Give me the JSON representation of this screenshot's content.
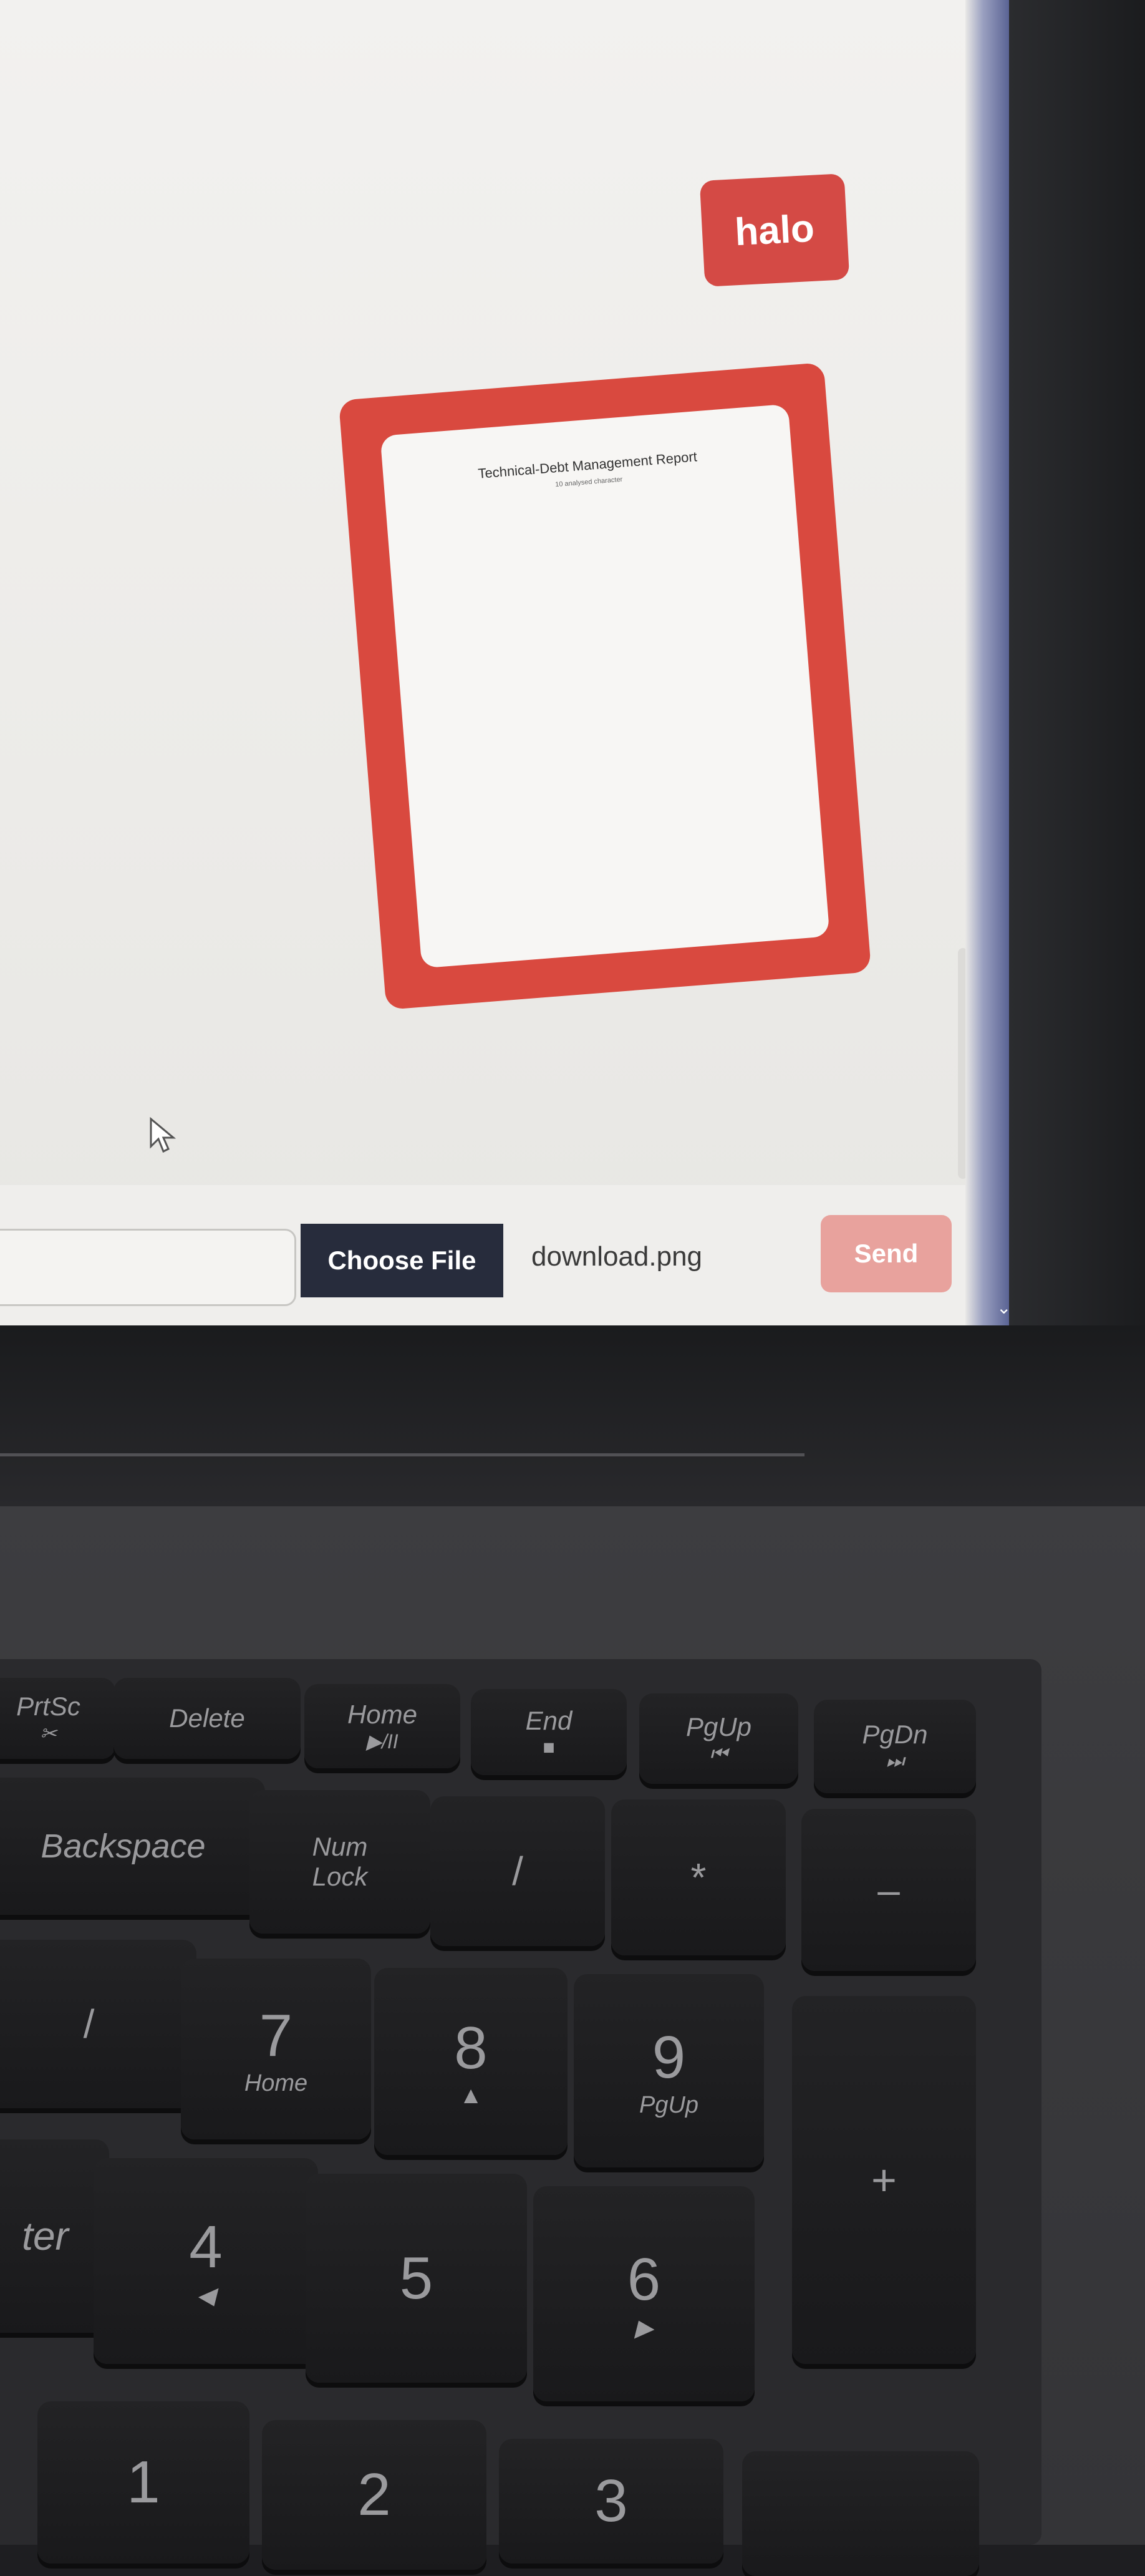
{
  "chat": {
    "message_text": "halo",
    "attachment_preview": {
      "title": "Technical-Debt Management Report",
      "subtitle": "10 analysed character"
    }
  },
  "composer": {
    "input_value": "",
    "choose_file_label": "Choose File",
    "selected_file": "download.png",
    "send_label": "Send"
  },
  "keyboard": {
    "row1": [
      {
        "main": "PrtSc",
        "sub": "✂"
      },
      {
        "main": "Delete",
        "sub": ""
      },
      {
        "main": "Home",
        "sub": "▶/II"
      },
      {
        "main": "End",
        "sub": "■"
      },
      {
        "main": "PgUp",
        "sub": "⏮"
      },
      {
        "main": "PgDn",
        "sub": "⏭"
      }
    ],
    "row2": [
      {
        "main": "Backspace",
        "sub": ""
      },
      {
        "main": "Num",
        "sub": "Lock"
      },
      {
        "main": "/",
        "sub": ""
      },
      {
        "main": "*",
        "sub": ""
      },
      {
        "main": "–",
        "sub": ""
      }
    ],
    "row3": [
      {
        "main": "/",
        "sub": ""
      },
      {
        "main": "7",
        "sub": "Home"
      },
      {
        "main": "8",
        "sub": "▲"
      },
      {
        "main": "9",
        "sub": "PgUp"
      },
      {
        "main": "+",
        "sub": ""
      }
    ],
    "row4": [
      {
        "main": "ter",
        "sub": ""
      },
      {
        "main": "4",
        "sub": "◀"
      },
      {
        "main": "5",
        "sub": ""
      },
      {
        "main": "6",
        "sub": "▶"
      }
    ],
    "row5": [
      {
        "main": "1",
        "sub": ""
      },
      {
        "main": "2",
        "sub": ""
      },
      {
        "main": "3",
        "sub": ""
      }
    ]
  },
  "colors": {
    "accent": "#d44a45",
    "send_disabled": "#e8a29d",
    "choose_file_bg": "#272c3c"
  }
}
